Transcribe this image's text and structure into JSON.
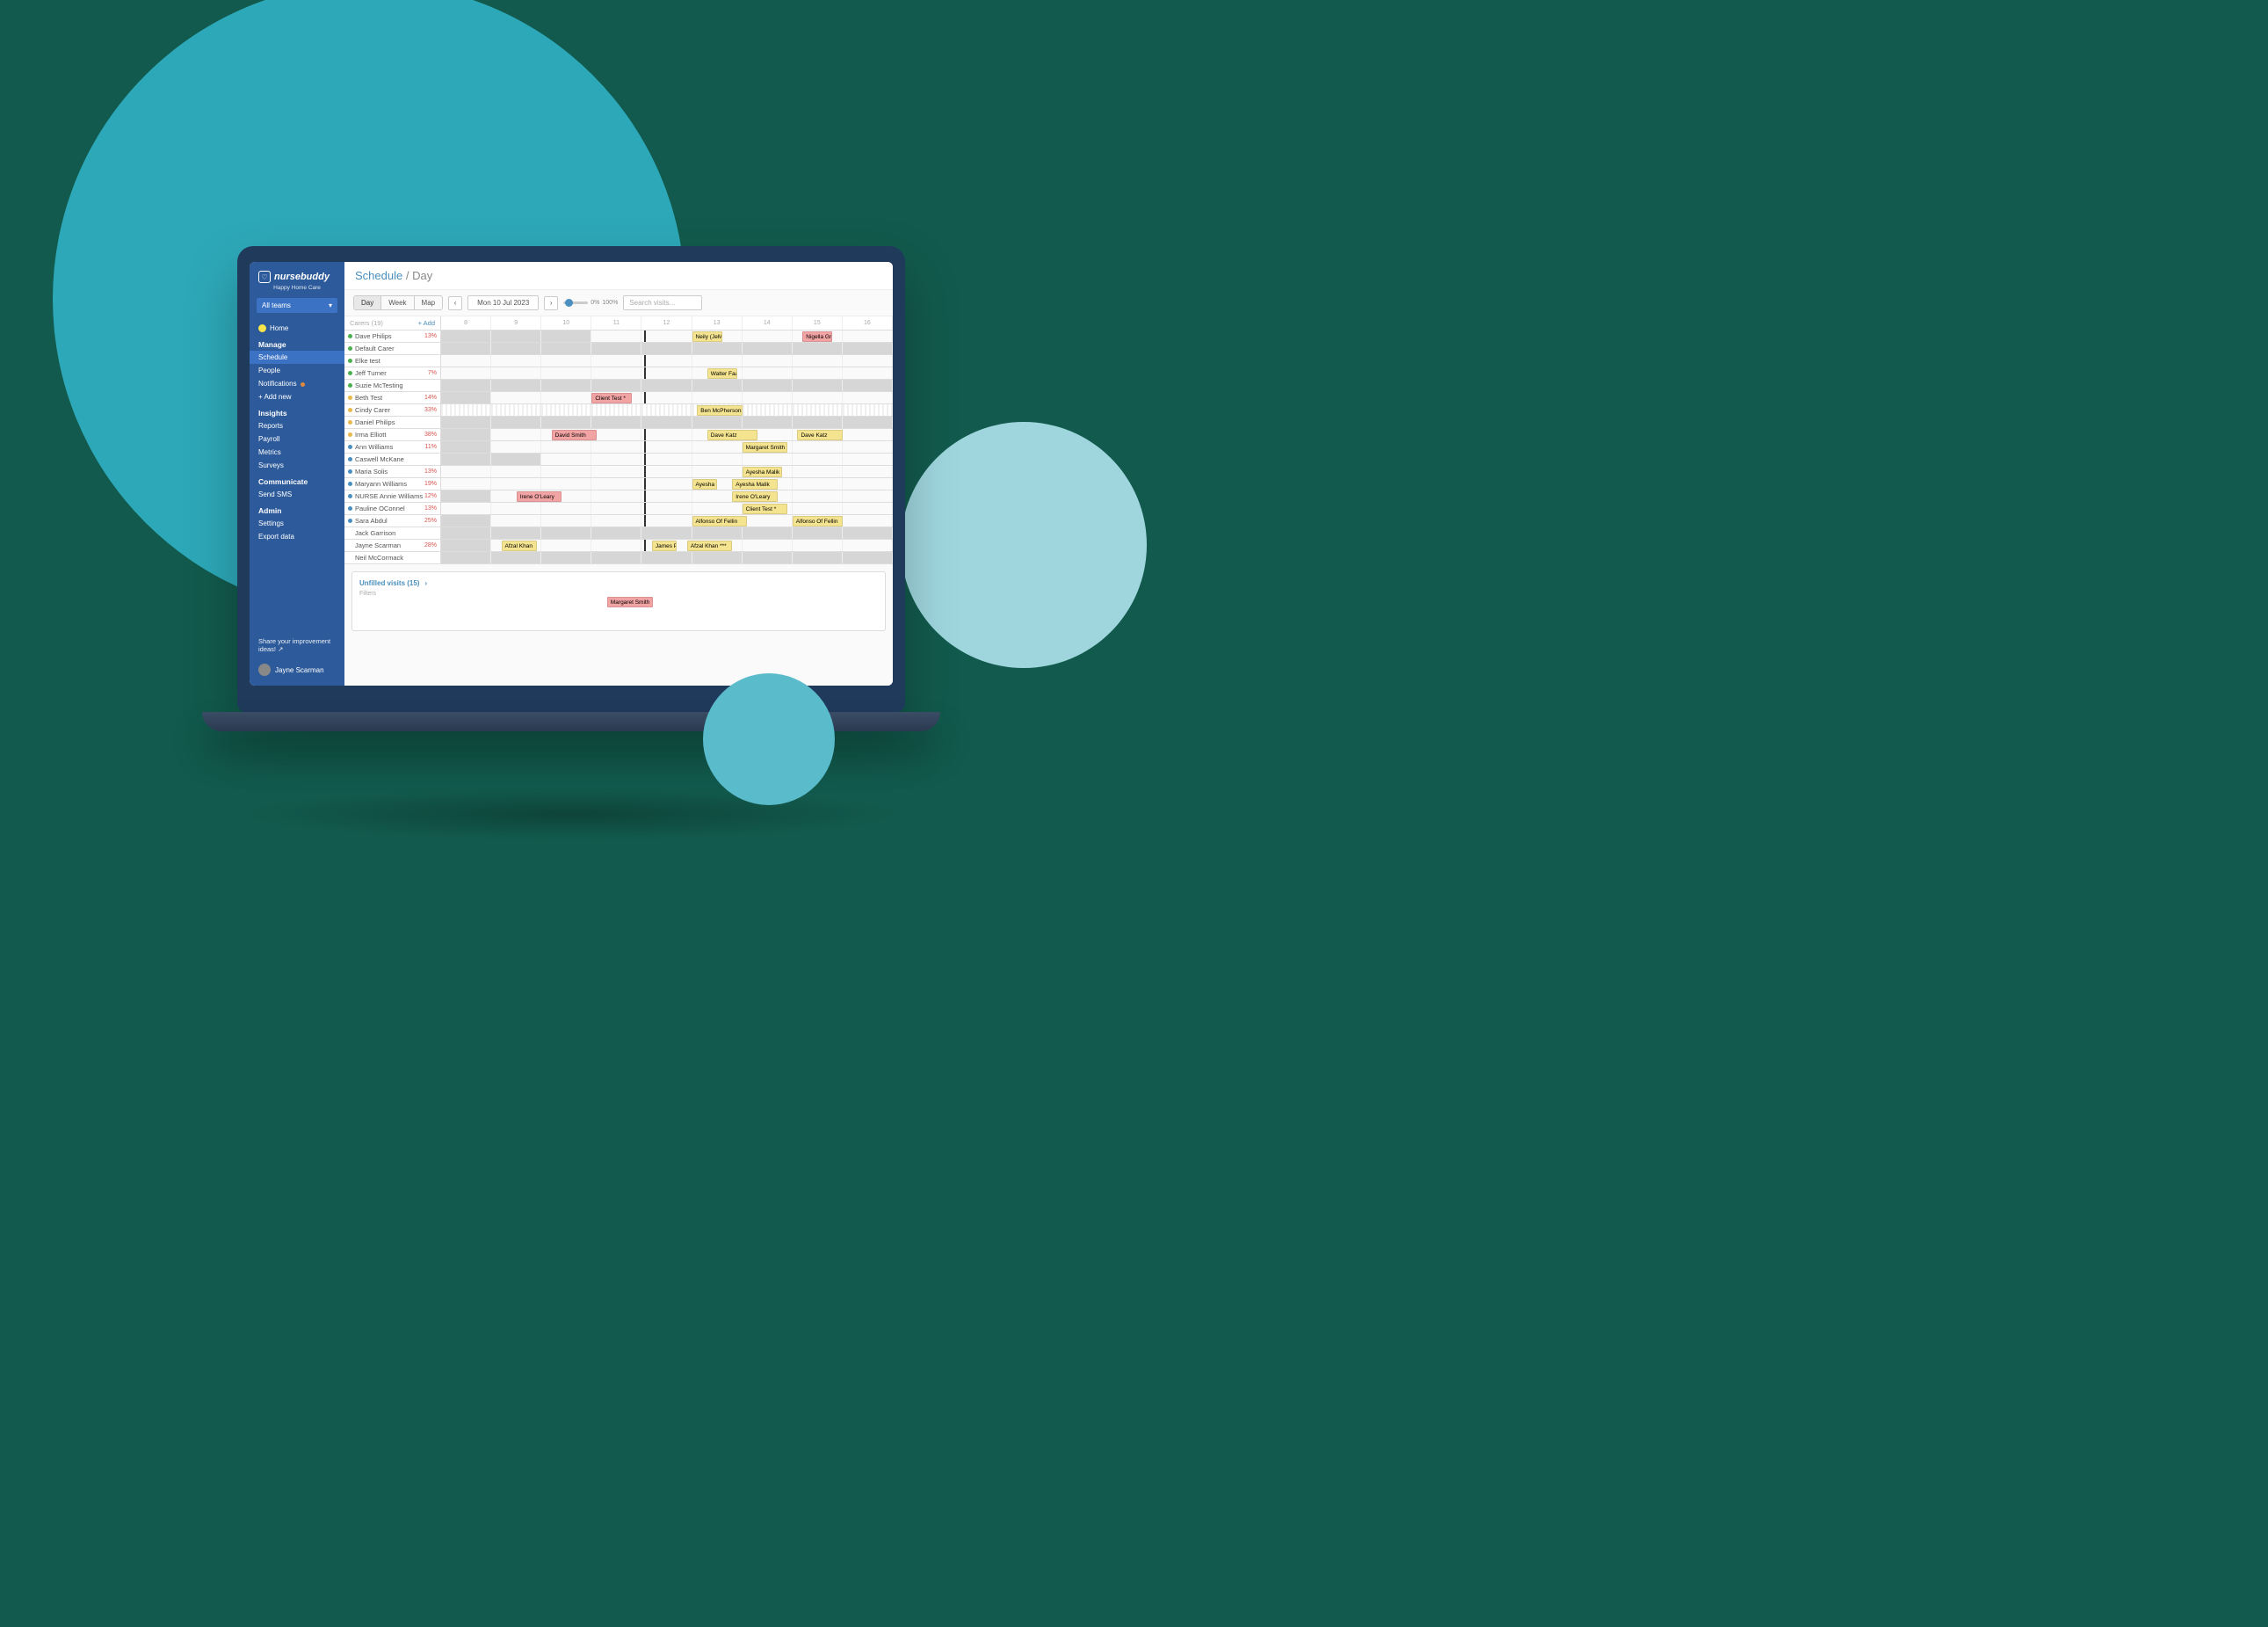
{
  "brand": {
    "name": "nursebuddy",
    "tagline": "Happy Home Care"
  },
  "teams_dropdown": "All teams",
  "sidebar": {
    "home": "Home",
    "sections": [
      {
        "heading": "Manage",
        "items": [
          "Schedule",
          "People",
          "Notifications",
          "+ Add new"
        ],
        "active_index": 0,
        "badge_index": 2
      },
      {
        "heading": "Insights",
        "items": [
          "Reports",
          "Payroll",
          "Metrics",
          "Surveys"
        ]
      },
      {
        "heading": "Communicate",
        "items": [
          "Send SMS"
        ]
      },
      {
        "heading": "Admin",
        "items": [
          "Settings",
          "Export data"
        ]
      }
    ],
    "share": "Share your improvement ideas!",
    "user": "Jayne Scarman"
  },
  "breadcrumb": {
    "root": "Schedule",
    "leaf": "Day"
  },
  "toolbar": {
    "views": [
      "Day",
      "Week",
      "Map"
    ],
    "active_view": 0,
    "date": "Mon 10 Jul 2023",
    "zoom_min": "0%",
    "zoom_max": "100%",
    "search_placeholder": "Search visits..."
  },
  "grid": {
    "carers_header": "Carers (19)",
    "add_label": "+ Add",
    "hours": [
      "8",
      "9",
      "10",
      "11",
      "12",
      "13",
      "14",
      "15",
      "16"
    ],
    "rows": [
      {
        "name": "Dave Philips",
        "pct": "13%",
        "dot": "g",
        "off": [
          0,
          1,
          2
        ],
        "visits": [
          {
            "label": "Neily (JeMarq)",
            "start": 5.0,
            "len": 0.6,
            "c": "yellow"
          },
          {
            "label": "Nigella Grant",
            "start": 7.2,
            "len": 0.6,
            "c": "red"
          }
        ]
      },
      {
        "name": "Default Carer",
        "pct": "",
        "dot": "g",
        "off": [
          0,
          1,
          2,
          3,
          4,
          5,
          6,
          7,
          8
        ],
        "visits": []
      },
      {
        "name": "Elke test",
        "pct": "",
        "dot": "g",
        "off": [],
        "visits": []
      },
      {
        "name": "Jeff Turner",
        "pct": "7%",
        "dot": "g",
        "off": [],
        "visits": [
          {
            "label": "Walter Faasn",
            "start": 5.3,
            "len": 0.6,
            "c": "yellow"
          }
        ]
      },
      {
        "name": "Suzie McTesting",
        "pct": "",
        "dot": "g",
        "off": [
          0,
          1,
          2,
          3,
          4,
          5,
          6,
          7,
          8
        ],
        "visits": []
      },
      {
        "name": "Beth Test",
        "pct": "14%",
        "dot": "y",
        "off": [
          0
        ],
        "visits": [
          {
            "label": "Client Test *",
            "start": 3.0,
            "len": 0.8,
            "c": "red"
          }
        ]
      },
      {
        "name": "Cindy Carer",
        "pct": "33%",
        "dot": "y",
        "off": [
          0
        ],
        "dashed": true,
        "visits": [
          {
            "label": "Ben McPherson",
            "start": 5.1,
            "len": 0.9,
            "c": "yellow"
          }
        ]
      },
      {
        "name": "Daniel Philips",
        "pct": "",
        "dot": "y",
        "off": [
          0,
          1,
          2,
          3,
          4,
          5,
          6,
          7,
          8
        ],
        "visits": []
      },
      {
        "name": "Irma Elliott",
        "pct": "38%",
        "dot": "y",
        "off": [
          0
        ],
        "visits": [
          {
            "label": "David Smith",
            "start": 2.2,
            "len": 0.9,
            "c": "red"
          },
          {
            "label": "Dave Katz",
            "start": 5.3,
            "len": 1.0,
            "c": "yellow"
          },
          {
            "label": "Dave Katz",
            "start": 7.1,
            "len": 0.9,
            "c": "yellow"
          }
        ]
      },
      {
        "name": "Ann Williams",
        "pct": "11%",
        "dot": "b",
        "off": [
          0
        ],
        "visits": [
          {
            "label": "Margaret Smith",
            "start": 6.0,
            "len": 0.9,
            "c": "yellow"
          }
        ]
      },
      {
        "name": "Caswell McKane",
        "pct": "",
        "dot": "b",
        "off": [
          0,
          1
        ],
        "visits": []
      },
      {
        "name": "Maria Solis",
        "pct": "13%",
        "dot": "b",
        "off": [],
        "visits": [
          {
            "label": "Ayesha Malik",
            "start": 6.0,
            "len": 0.8,
            "c": "yellow"
          }
        ]
      },
      {
        "name": "Maryann Williams",
        "pct": "19%",
        "dot": "b",
        "off": [],
        "visits": [
          {
            "label": "Ayesha Malik",
            "start": 5.0,
            "len": 0.5,
            "c": "yellow"
          },
          {
            "label": "Ayesha Malik",
            "start": 5.8,
            "len": 0.9,
            "c": "yellow"
          }
        ]
      },
      {
        "name": "NURSE Annie Williams",
        "pct": "12%",
        "dot": "b",
        "off": [
          0
        ],
        "visits": [
          {
            "label": "Irene O'Leary",
            "start": 1.5,
            "len": 0.9,
            "c": "red"
          },
          {
            "label": "Irene O'Leary",
            "start": 5.8,
            "len": 0.9,
            "c": "yellow"
          }
        ]
      },
      {
        "name": "Pauline OConnel",
        "pct": "13%",
        "dot": "b",
        "off": [],
        "visits": [
          {
            "label": "Client Test *",
            "start": 6.0,
            "len": 0.9,
            "c": "yellow"
          }
        ]
      },
      {
        "name": "Sara Abdul",
        "pct": "25%",
        "dot": "b",
        "off": [
          0
        ],
        "visits": [
          {
            "label": "Alfonso Of Fellin",
            "start": 5.0,
            "len": 1.1,
            "c": "yellow"
          },
          {
            "label": "Alfonso Of Fellin",
            "start": 7.0,
            "len": 1.0,
            "c": "yellow"
          }
        ]
      },
      {
        "name": "Jack Garrison",
        "pct": "",
        "dot": "n",
        "off": [
          0,
          1,
          2,
          3,
          4,
          5,
          6,
          7,
          8
        ],
        "visits": []
      },
      {
        "name": "Jayne Scarman",
        "pct": "28%",
        "dot": "n",
        "off": [
          0
        ],
        "visits": [
          {
            "label": "Afzal Khan",
            "start": 1.2,
            "len": 0.7,
            "c": "yellow"
          },
          {
            "label": "James Peters",
            "start": 4.2,
            "len": 0.5,
            "c": "yellow"
          },
          {
            "label": "Afzal Khan ***",
            "start": 4.9,
            "len": 0.9,
            "c": "yellow"
          }
        ]
      },
      {
        "name": "Neil McCormack",
        "pct": "",
        "dot": "n",
        "off": [
          0,
          1,
          2,
          3,
          4,
          5,
          6,
          7,
          8
        ],
        "visits": []
      }
    ]
  },
  "unfilled": {
    "title": "Unfilled visits (15)",
    "filter": "Filters",
    "visit": {
      "label": "Margaret Smith",
      "start": 4.3,
      "len": 0.8
    }
  }
}
